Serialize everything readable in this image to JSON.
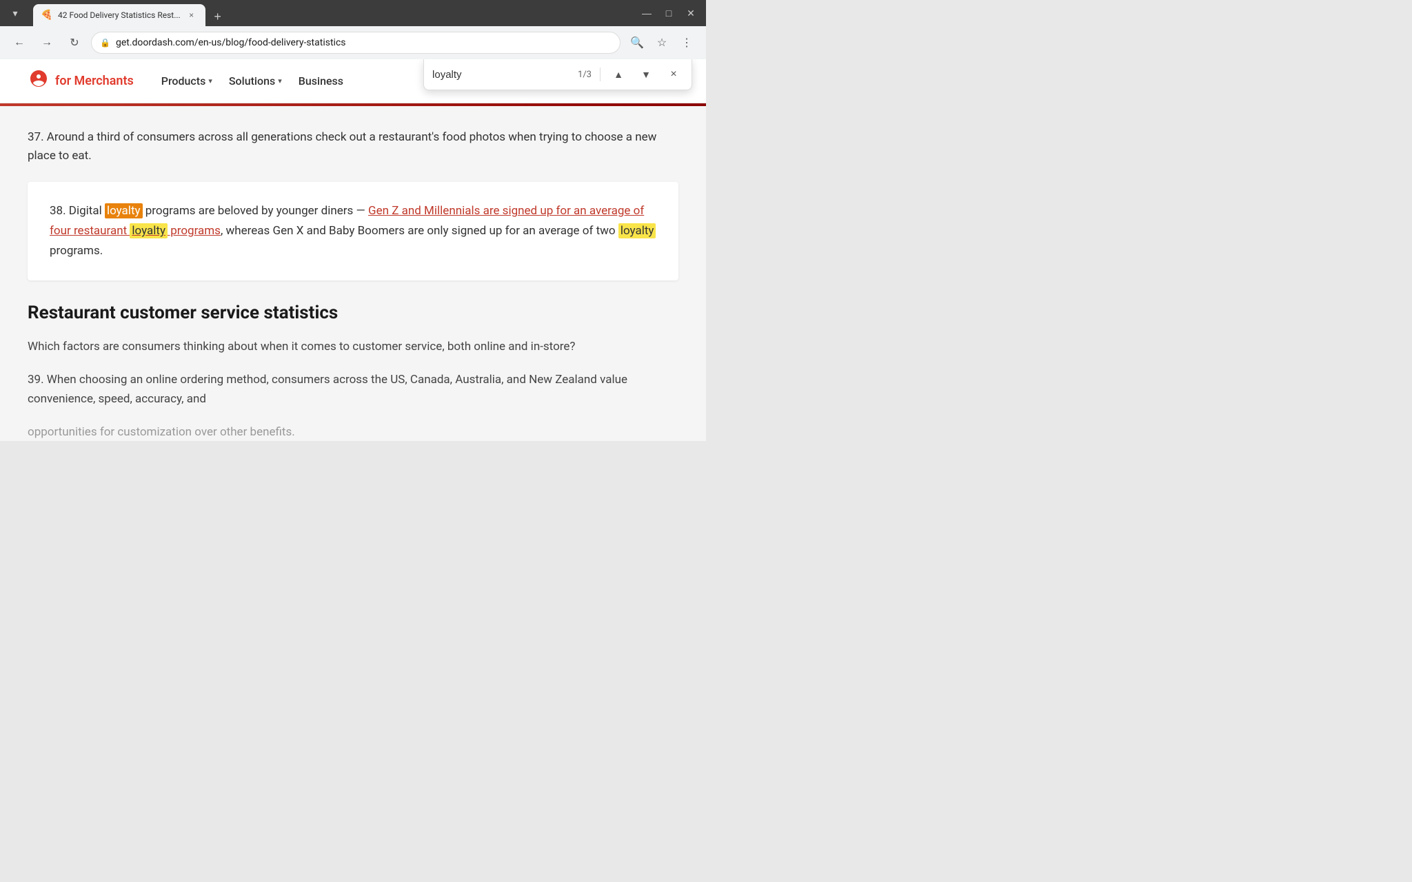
{
  "browser": {
    "tab": {
      "favicon": "🍕",
      "title": "42 Food Delivery Statistics Rest...",
      "close_label": "×"
    },
    "new_tab_label": "+",
    "window_controls": {
      "minimize": "—",
      "maximize": "□",
      "close": "✕"
    },
    "toolbar": {
      "back_label": "←",
      "forward_label": "→",
      "reload_label": "↻",
      "address": "get.doordash.com/en-us/blog/food-delivery-statistics",
      "address_icon": "🔒",
      "search_icon": "🔍",
      "bookmark_icon": "☆",
      "menu_icon": "⋮"
    }
  },
  "find_bar": {
    "query": "loyalty",
    "count": "1/3",
    "prev_label": "▲",
    "next_label": "▼",
    "close_label": "×"
  },
  "site": {
    "logo_icon": "⬛",
    "for_merchants": "for Merchants",
    "nav": {
      "products": "Products",
      "products_chevron": "▾",
      "solutions": "Solutions",
      "solutions_chevron": "▾",
      "business": "Business"
    }
  },
  "article": {
    "stat37": "37. Around a third of consumers across all generations check out a restaurant's food photos when trying to choose a new place to eat.",
    "stat38": {
      "prefix": "38. Digital ",
      "loyalty1": "loyalty",
      "middle": " programs are beloved by younger diners — ",
      "link": "Gen Z and Millennials are signed up for an average of four restaurant loyalty programs",
      "link_loyalty": "loyalty",
      "suffix": ", whereas Gen X and Baby Boomers are only signed up for an average of two ",
      "loyalty3": "loyalty",
      "end": " programs."
    },
    "section_heading": "Restaurant customer service statistics",
    "body1": "Which factors are consumers thinking about when it comes to customer service, both online and in-store?",
    "stat39": "39. When choosing an online ordering method, consumers across the US, Canada, Australia, and New Zealand value convenience, speed, accuracy, and",
    "stat39_faded": "opportunities for customization over other benefits."
  }
}
